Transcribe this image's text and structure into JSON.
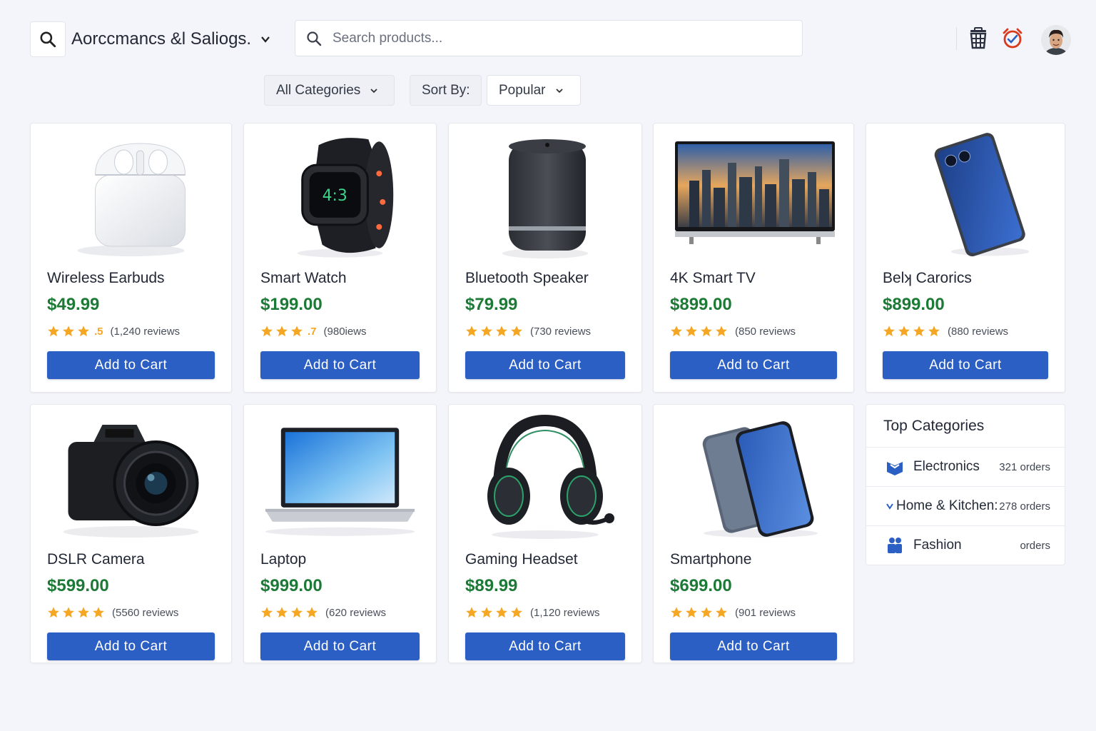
{
  "header": {
    "store_name": "Aorccmancs &l Saliogs.",
    "search_placeholder": "Search products...",
    "icons": [
      "search-icon",
      "cart-icon",
      "alert-icon",
      "user-avatar"
    ]
  },
  "filters": {
    "category": "All Categories",
    "sort_label": "Sort By:",
    "sort_value": "Popular"
  },
  "colors": {
    "accent": "#2c5fc4",
    "price": "#1d7a36",
    "star": "#f5a623",
    "background": "#f4f5fa"
  },
  "products": [
    {
      "name": "Wireless Earbuds",
      "price": "$49.99",
      "rating_text": ".5",
      "stars": 3,
      "reviews": "(1,240 reviews",
      "button": "Add to Cart",
      "image": "earbuds"
    },
    {
      "name": "Smart Watch",
      "price": "$199.00",
      "rating_text": ".7",
      "stars": 3,
      "reviews": "(980iews",
      "button": "Add to Cart",
      "image": "watch"
    },
    {
      "name": "Bluetooth Speaker",
      "price": "$79.99",
      "rating_text": "",
      "stars": 4,
      "reviews": "(730 reviews",
      "button": "Add to Cart",
      "image": "speaker"
    },
    {
      "name": "4K Smart TV",
      "price": "$899.00",
      "rating_text": "",
      "stars": 4,
      "reviews": "(850 reviews",
      "button": "Add to Cart",
      "image": "tv"
    },
    {
      "name": "Belʞ Carorics",
      "price": "$899.00",
      "rating_text": "",
      "stars": 4,
      "reviews": "(880 reviews",
      "button": "Add to Cart",
      "image": "tablet"
    },
    {
      "name": "DSLR Camera",
      "price": "$599.00",
      "rating_text": "",
      "stars": 4,
      "reviews": "(5560 reviews",
      "button": "Add to Cart",
      "image": "camera"
    },
    {
      "name": "Laptop",
      "price": "$999.00",
      "rating_text": "",
      "stars": 4,
      "reviews": "(620 reviews",
      "button": "Add to Cart",
      "image": "laptop"
    },
    {
      "name": "Gaming Headset",
      "price": "$89.99",
      "rating_text": "",
      "stars": 4,
      "reviews": "(1,120 reviews",
      "button": "Add to Cart",
      "image": "headset"
    },
    {
      "name": "Smartphone",
      "price": "$699.00",
      "rating_text": "",
      "stars": 4,
      "reviews": "(901 reviews",
      "button": "Add to Cart",
      "image": "phone"
    }
  ],
  "top_categories": {
    "title": "Top Categories",
    "items": [
      {
        "name": "Electronics",
        "orders": "321 orders",
        "icon": "electronics-icon"
      },
      {
        "name": "Home & Kitchen:",
        "orders": "278 orders",
        "icon": "home-kitchen-icon"
      },
      {
        "name": "Fashion",
        "orders": "orders",
        "icon": "fashion-icon"
      }
    ]
  }
}
